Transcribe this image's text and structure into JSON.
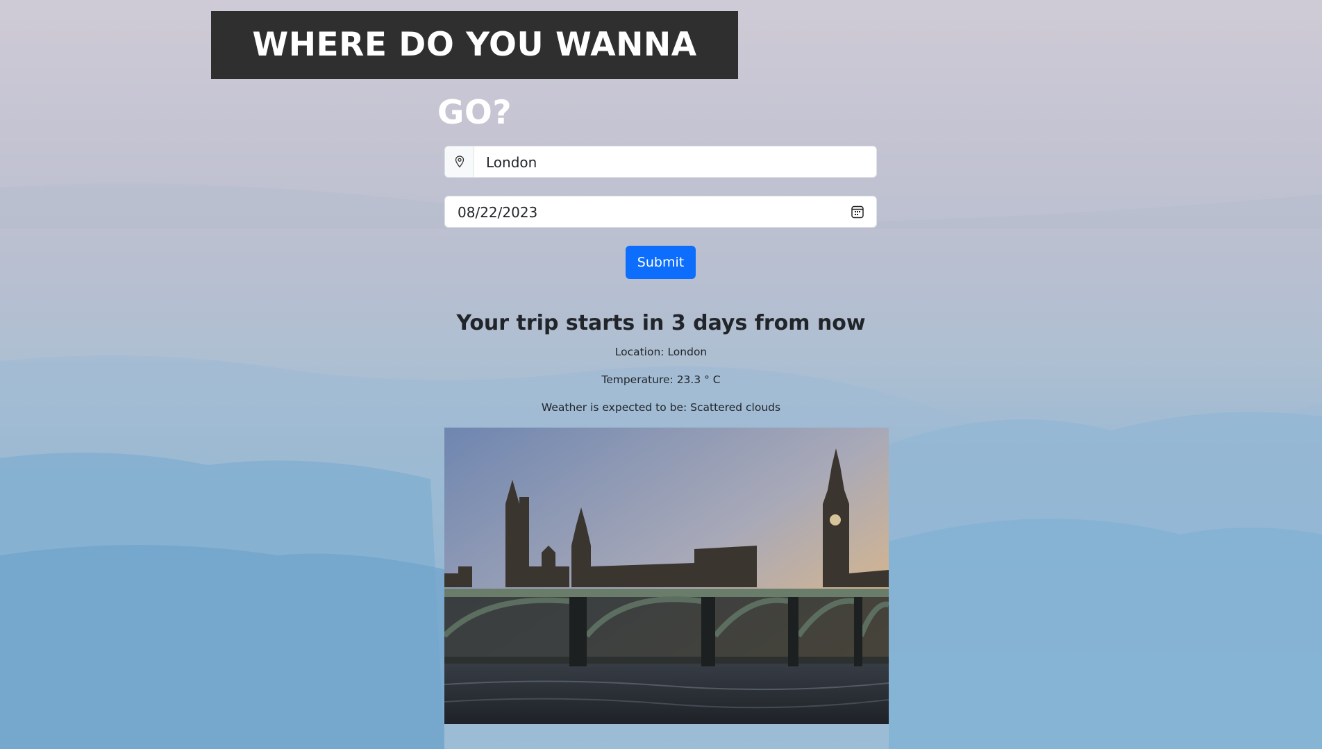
{
  "header": {
    "title": "WHERE DO YOU WANNA GO?"
  },
  "form": {
    "location_value": "London",
    "date_value": "08/22/2023",
    "submit_label": "Submit"
  },
  "result": {
    "heading": "Your trip starts in 3 days from now",
    "location": "Location: London",
    "temperature": "Temperature: 23.3 ° C",
    "weather": "Weather is expected to be: Scattered clouds"
  },
  "colors": {
    "accent": "#0d6efd",
    "title_bg": "#2f2f2f"
  }
}
